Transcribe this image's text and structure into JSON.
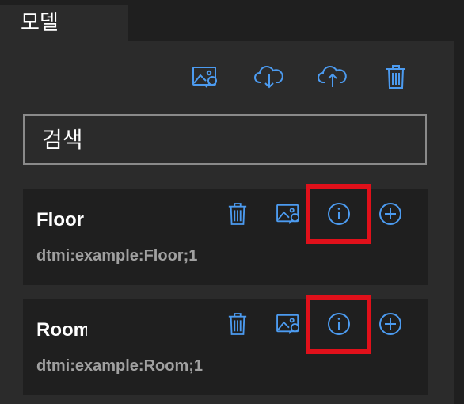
{
  "tab": {
    "label": "모델"
  },
  "toolbar": {
    "buttons": [
      {
        "name": "upload-image-button",
        "icon": "image-search-icon"
      },
      {
        "name": "download-button",
        "icon": "cloud-download-icon"
      },
      {
        "name": "upload-button",
        "icon": "cloud-upload-icon"
      },
      {
        "name": "delete-all-button",
        "icon": "trash-icon"
      }
    ]
  },
  "search": {
    "placeholder": "검색"
  },
  "models": [
    {
      "title": "Floor",
      "id": "dtmi:example:Floor;1"
    },
    {
      "title": "Room",
      "id": "dtmi:example:Room;1"
    }
  ],
  "colors": {
    "accent": "#4c9bf0",
    "highlight": "#e0101a",
    "background": "#1f1f1f",
    "panel": "#2b2b2b"
  }
}
